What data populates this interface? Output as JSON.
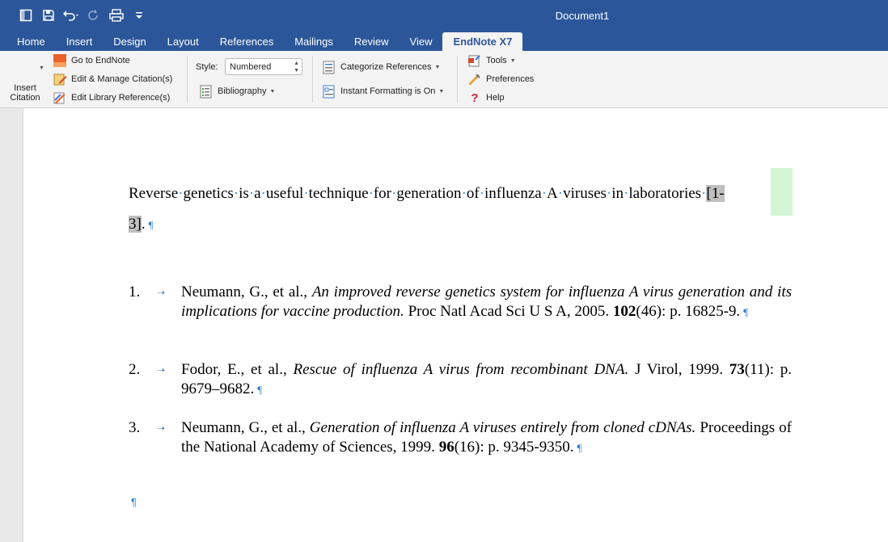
{
  "window": {
    "title": "Document1"
  },
  "quick_access": {
    "icons": [
      "sidebar-icon",
      "save-icon",
      "undo-icon",
      "redo-icon",
      "print-icon",
      "customize-icon"
    ]
  },
  "tabs": [
    {
      "label": "Home"
    },
    {
      "label": "Insert"
    },
    {
      "label": "Design"
    },
    {
      "label": "Layout"
    },
    {
      "label": "References"
    },
    {
      "label": "Mailings"
    },
    {
      "label": "Review"
    },
    {
      "label": "View"
    },
    {
      "label": "EndNote X7",
      "active": true
    }
  ],
  "ribbon": {
    "insert_citation": {
      "line1": "Insert",
      "line2": "Citation"
    },
    "go_to_endnote": "Go to EndNote",
    "edit_manage": "Edit & Manage Citation(s)",
    "edit_library": "Edit Library Reference(s)",
    "style_label": "Style:",
    "style_value": "Numbered",
    "bibliography": "Bibliography",
    "categorize": "Categorize References",
    "instant_formatting": "Instant Formatting is On",
    "tools": "Tools",
    "preferences": "Preferences",
    "help": "Help",
    "colors": {
      "accent": "#2b579a",
      "ribbon_bg": "#f3f3f3"
    }
  },
  "document": {
    "intro_words": [
      "Reverse",
      "genetics",
      "is",
      "a",
      "useful",
      "technique",
      "for",
      "generation",
      "of",
      "influenza",
      "A",
      "viruses",
      "in",
      "laboratories"
    ],
    "citation_part1": "[1-",
    "citation_part2": "3]",
    "period": ".",
    "pilcrow": "¶",
    "references": [
      {
        "num": "1.",
        "authors": "Neumann, G., et al.,",
        "title": "An improved reverse genetics system for influenza A virus generation and its implications for vaccine production.",
        "journal": "Proc Natl Acad Sci U S A, 2005.",
        "volume": "102",
        "rest": "(46): p. 16825-9."
      },
      {
        "num": "2.",
        "authors": "Fodor, E., et al.,",
        "title": "Rescue of influenza A virus from recombinant DNA.",
        "journal": "J Virol, 1999.",
        "volume": "73",
        "rest": "(11): p. 9679–9682."
      },
      {
        "num": "3.",
        "authors": "Neumann, G., et al.,",
        "title": "Generation of influenza A viruses entirely from cloned cDNAs.",
        "journal": "Proceedings of the National Academy of Sciences, 1999.",
        "volume": "96",
        "rest": "(16): p. 9345-9350."
      }
    ]
  }
}
